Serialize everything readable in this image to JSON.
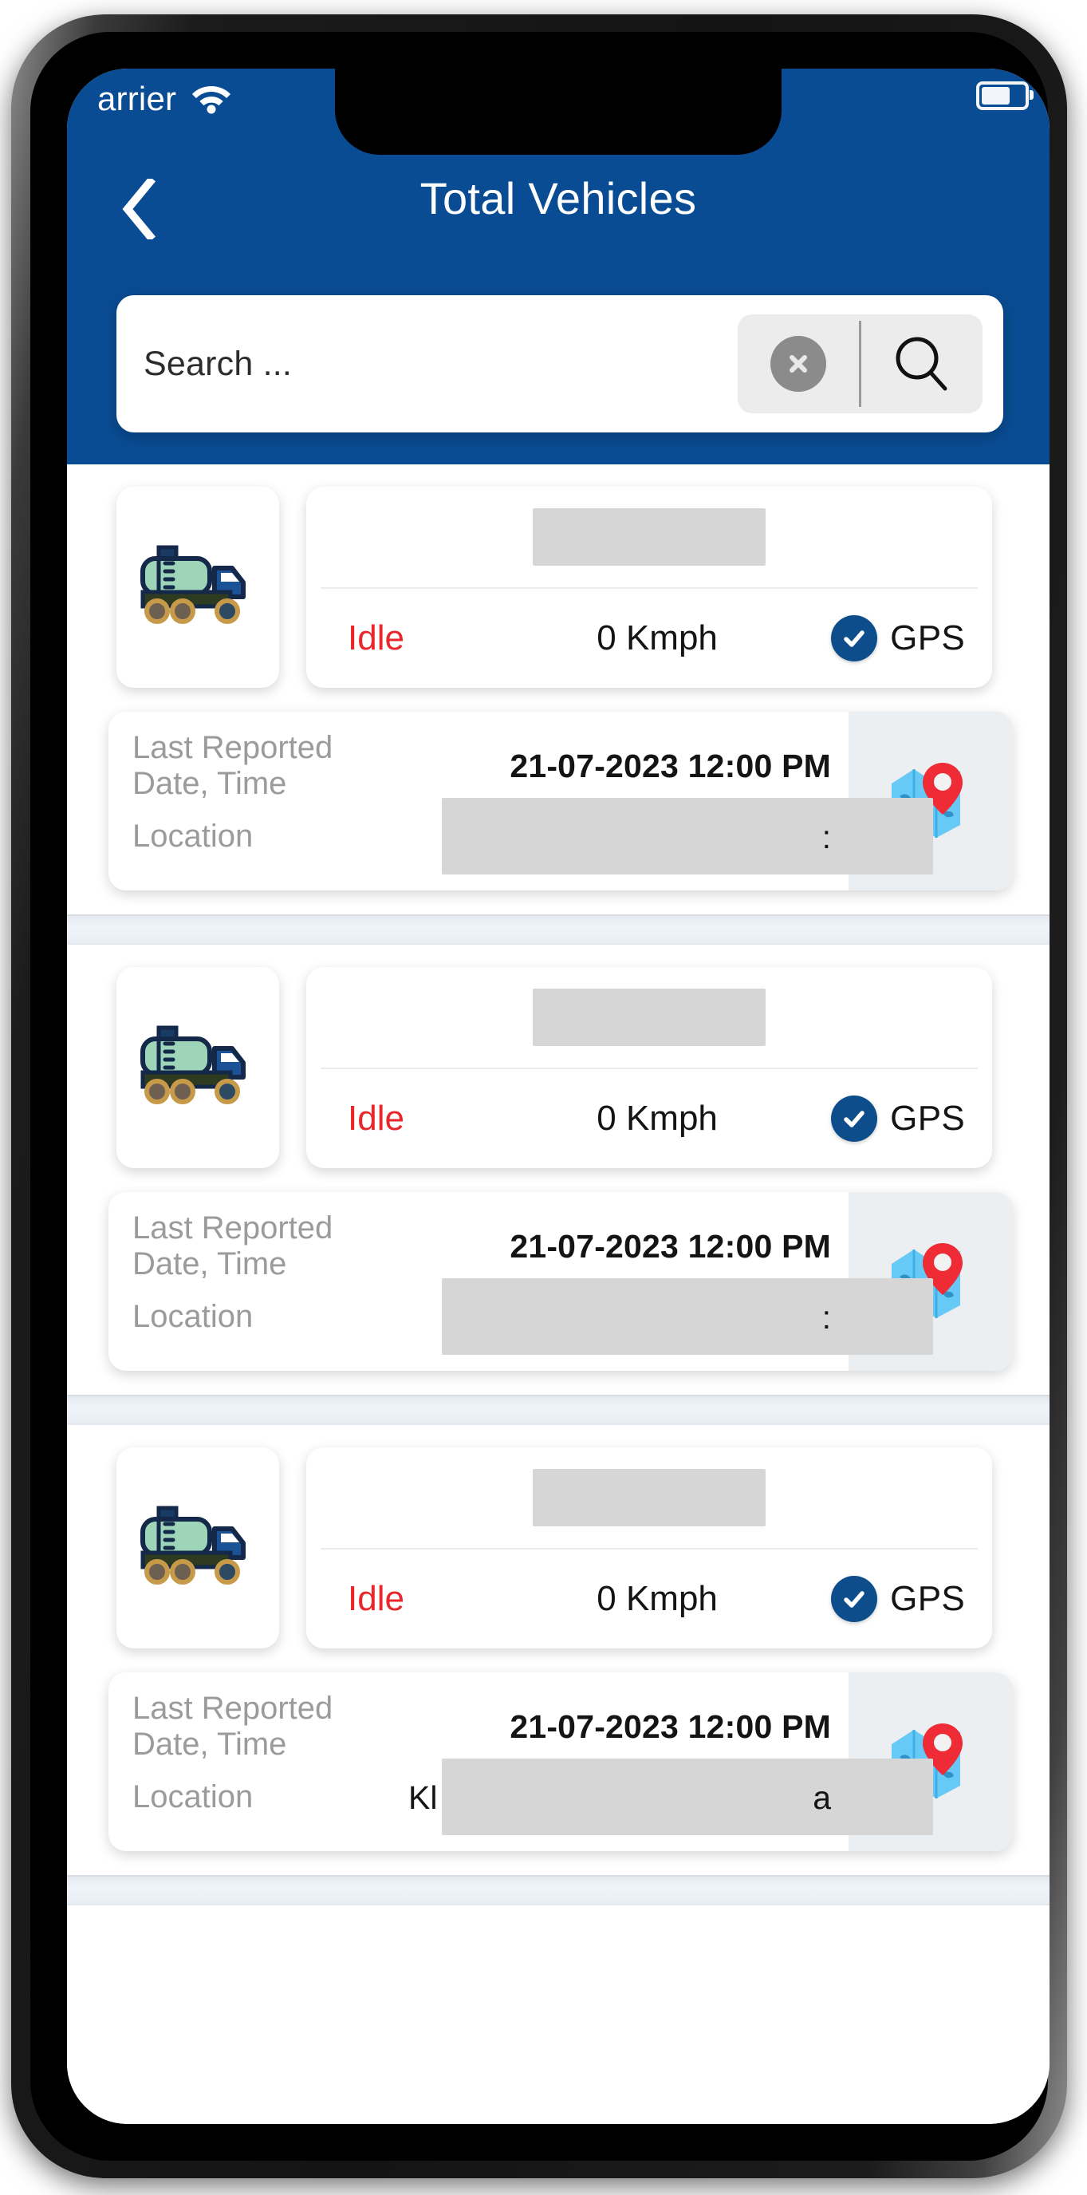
{
  "status_bar": {
    "carrier": "arrier",
    "wifi_icon": "wifi-icon",
    "battery_icon": "battery-icon"
  },
  "app_bar": {
    "back_icon": "chevron-left-icon",
    "title": "Total Vehicles"
  },
  "search": {
    "placeholder": "Search ...",
    "value": "",
    "clear_icon": "close-circle-icon",
    "search_icon": "magnifier-icon"
  },
  "labels": {
    "last_reported": "Last Reported Date, Time",
    "location": "Location",
    "gps": "GPS",
    "truck_icon": "tanker-truck-icon",
    "map_icon": "map-pin-icon",
    "gps_check_icon": "check-circle-icon"
  },
  "colors": {
    "brand_blue": "#0a4c93",
    "status_red": "#e8262b",
    "gps_blue": "#0d4d8c",
    "redaction_gray": "#d6d6d6"
  },
  "vehicles": [
    {
      "vehicle_number": "",
      "status": "Idle",
      "speed": "0 Kmph",
      "gps": "GPS",
      "last_reported": "21-07-2023 12:00 PM",
      "location_prefix": "",
      "location_suffix": ":"
    },
    {
      "vehicle_number": "",
      "status": "Idle",
      "speed": "0 Kmph",
      "gps": "GPS",
      "last_reported": "21-07-2023 12:00 PM",
      "location_prefix": "",
      "location_suffix": ":"
    },
    {
      "vehicle_number": "",
      "status": "Idle",
      "speed": "0 Kmph",
      "gps": "GPS",
      "last_reported": "21-07-2023 12:00 PM",
      "location_prefix": "Kl",
      "location_suffix": "a"
    }
  ]
}
